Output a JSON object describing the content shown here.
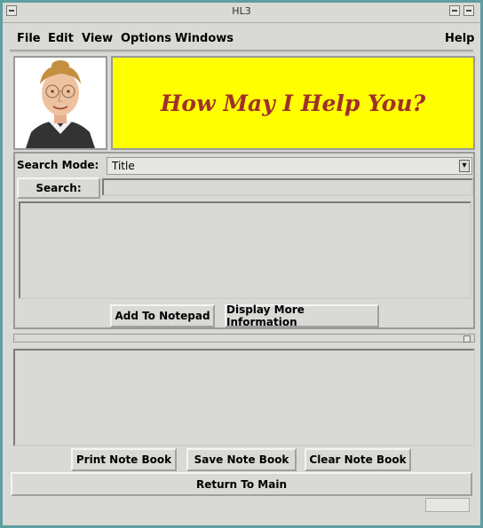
{
  "window": {
    "title": "HL3"
  },
  "menu": {
    "file": "File",
    "edit": "Edit",
    "view": "View",
    "options": "Options",
    "windows": "Windows",
    "help": "Help"
  },
  "banner": {
    "text": "How May I Help You?"
  },
  "search": {
    "mode_label": "Search Mode:",
    "mode_value": "Title",
    "button": "Search:",
    "query": ""
  },
  "actions": {
    "add_to_notepad": "Add To Notepad",
    "display_more": "Display More Information"
  },
  "notebook": {
    "print": "Print Note Book",
    "save": "Save Note Book",
    "clear": "Clear Note Book",
    "return_main": "Return To Main"
  },
  "colors": {
    "banner_bg": "#ffff00",
    "banner_text": "#a0302a",
    "window_border": "#5f9ea0",
    "panel_bg": "#d9d9d6"
  },
  "icons": {
    "window_menu": "window-menu-icon",
    "minimize": "minimize-icon",
    "maximize": "maximize-icon",
    "avatar": "assistant-avatar"
  }
}
